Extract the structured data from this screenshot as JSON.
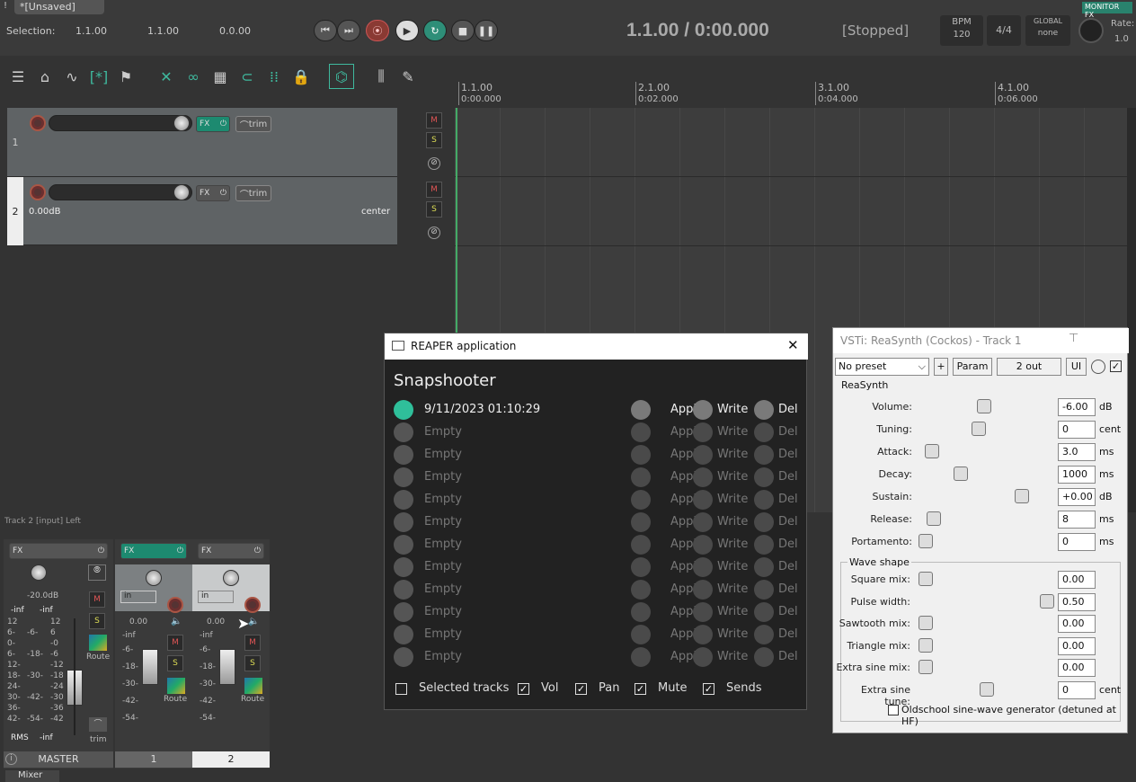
{
  "window": {
    "tab_label": "*[Unsaved]",
    "monitor_fx": "MONITOR FX"
  },
  "selection": {
    "label": "Selection:",
    "start": "1.1.00",
    "end": "1.1.00",
    "length": "0.0.00"
  },
  "transport": {
    "position": "1.1.00 / 0:00.000",
    "status": "[Stopped]",
    "bpm_label": "BPM",
    "bpm": "120",
    "time_sig": "4/4",
    "global_label": "GLOBAL",
    "global_value": "none",
    "rate_label": "Rate:",
    "rate_value": "1.0"
  },
  "timeline": {
    "markers": [
      {
        "bar": "1.1.00",
        "time": "0:00.000"
      },
      {
        "bar": "2.1.00",
        "time": "0:02.000"
      },
      {
        "bar": "3.1.00",
        "time": "0:04.000"
      },
      {
        "bar": "4.1.00",
        "time": "0:06.000"
      }
    ]
  },
  "tracks": [
    {
      "number": "1",
      "fx": "FX",
      "trim": "trim",
      "vol": "",
      "pan": ""
    },
    {
      "number": "2",
      "fx": "FX",
      "trim": "trim",
      "vol": "0.00dB",
      "pan": "center"
    }
  ],
  "track_buttons": {
    "mute": "M",
    "solo": "S"
  },
  "mixer": {
    "status": "Track 2 [input] Left",
    "master": {
      "name": "MASTER",
      "fx": "FX",
      "db": "-20.0dB",
      "peakL": "-inf",
      "peakR": "-inf",
      "rms": "RMS",
      "rms_val": "-inf",
      "trim": "trim",
      "route": "Route"
    },
    "strips": [
      {
        "name": "1",
        "fx": "FX",
        "input": "in",
        "vol": "0.00",
        "peak": "-inf",
        "route": "Route"
      },
      {
        "name": "2",
        "fx": "FX",
        "input": "in",
        "vol": "0.00",
        "peak": "-inf",
        "route": "Route"
      }
    ],
    "scale_left": [
      "12",
      "6-",
      "0-",
      "6-",
      "12-",
      "18-",
      "24-",
      "30-",
      "36-",
      "42-"
    ],
    "scale_mid": [
      "-6-",
      "-18-",
      "-30-",
      "-42-",
      "-54-"
    ],
    "scale_right": [
      "12",
      "6",
      "-0",
      "-6",
      "-12",
      "-18",
      "-24",
      "-30",
      "-36",
      "-42"
    ],
    "strip_scale": [
      "-6-",
      "-18-",
      "-30-",
      "-42-",
      "-54-"
    ],
    "tab_label": "Mixer"
  },
  "snapshooter": {
    "window_title": "REAPER application",
    "heading": "Snapshooter",
    "rows": [
      {
        "label": "9/11/2023 01:10:29",
        "active": true
      },
      {
        "label": "Empty",
        "active": false
      },
      {
        "label": "Empty",
        "active": false
      },
      {
        "label": "Empty",
        "active": false
      },
      {
        "label": "Empty",
        "active": false
      },
      {
        "label": "Empty",
        "active": false
      },
      {
        "label": "Empty",
        "active": false
      },
      {
        "label": "Empty",
        "active": false
      },
      {
        "label": "Empty",
        "active": false
      },
      {
        "label": "Empty",
        "active": false
      },
      {
        "label": "Empty",
        "active": false
      },
      {
        "label": "Empty",
        "active": false
      }
    ],
    "apply": "Apply",
    "write": "Write",
    "del": "Del",
    "options": [
      {
        "label": "Selected tracks",
        "checked": false
      },
      {
        "label": "Vol",
        "checked": true
      },
      {
        "label": "Pan",
        "checked": true
      },
      {
        "label": "Mute",
        "checked": true
      },
      {
        "label": "Sends",
        "checked": true
      }
    ]
  },
  "fxwindow": {
    "title": "VSTi: ReaSynth (Cockos) - Track 1",
    "preset": "No preset",
    "plus": "+",
    "param": "Param",
    "out": "2 out",
    "ui": "UI",
    "plugin_name": "ReaSynth",
    "wave_group": "Wave shape",
    "params": [
      {
        "label": "Volume:",
        "value": "-6.00",
        "unit": "dB",
        "pos": 0.48
      },
      {
        "label": "Tuning:",
        "value": "0",
        "unit": "cent",
        "pos": 0.44
      },
      {
        "label": "Attack:",
        "value": "3.0",
        "unit": "ms",
        "pos": 0.05
      },
      {
        "label": "Decay:",
        "value": "1000",
        "unit": "ms",
        "pos": 0.29
      },
      {
        "label": "Sustain:",
        "value": "+0.00",
        "unit": "dB",
        "pos": 0.79
      },
      {
        "label": "Release:",
        "value": "8",
        "unit": "ms",
        "pos": 0.07
      },
      {
        "label": "Portamento:",
        "value": "0",
        "unit": "ms",
        "pos": 0.0
      }
    ],
    "wave_params": [
      {
        "label": "Square mix:",
        "value": "0.00",
        "unit": "",
        "pos": 0.0
      },
      {
        "label": "Pulse width:",
        "value": "0.50",
        "unit": "",
        "pos": 1.0
      },
      {
        "label": "Sawtooth mix:",
        "value": "0.00",
        "unit": "",
        "pos": 0.0
      },
      {
        "label": "Triangle mix:",
        "value": "0.00",
        "unit": "",
        "pos": 0.0
      },
      {
        "label": "Extra sine mix:",
        "value": "0.00",
        "unit": "",
        "pos": 0.0
      },
      {
        "label": "Extra sine tune:",
        "value": "0",
        "unit": "cent",
        "pos": 0.5
      }
    ],
    "oldschool": "Oldschool sine-wave generator (detuned at HF)"
  }
}
